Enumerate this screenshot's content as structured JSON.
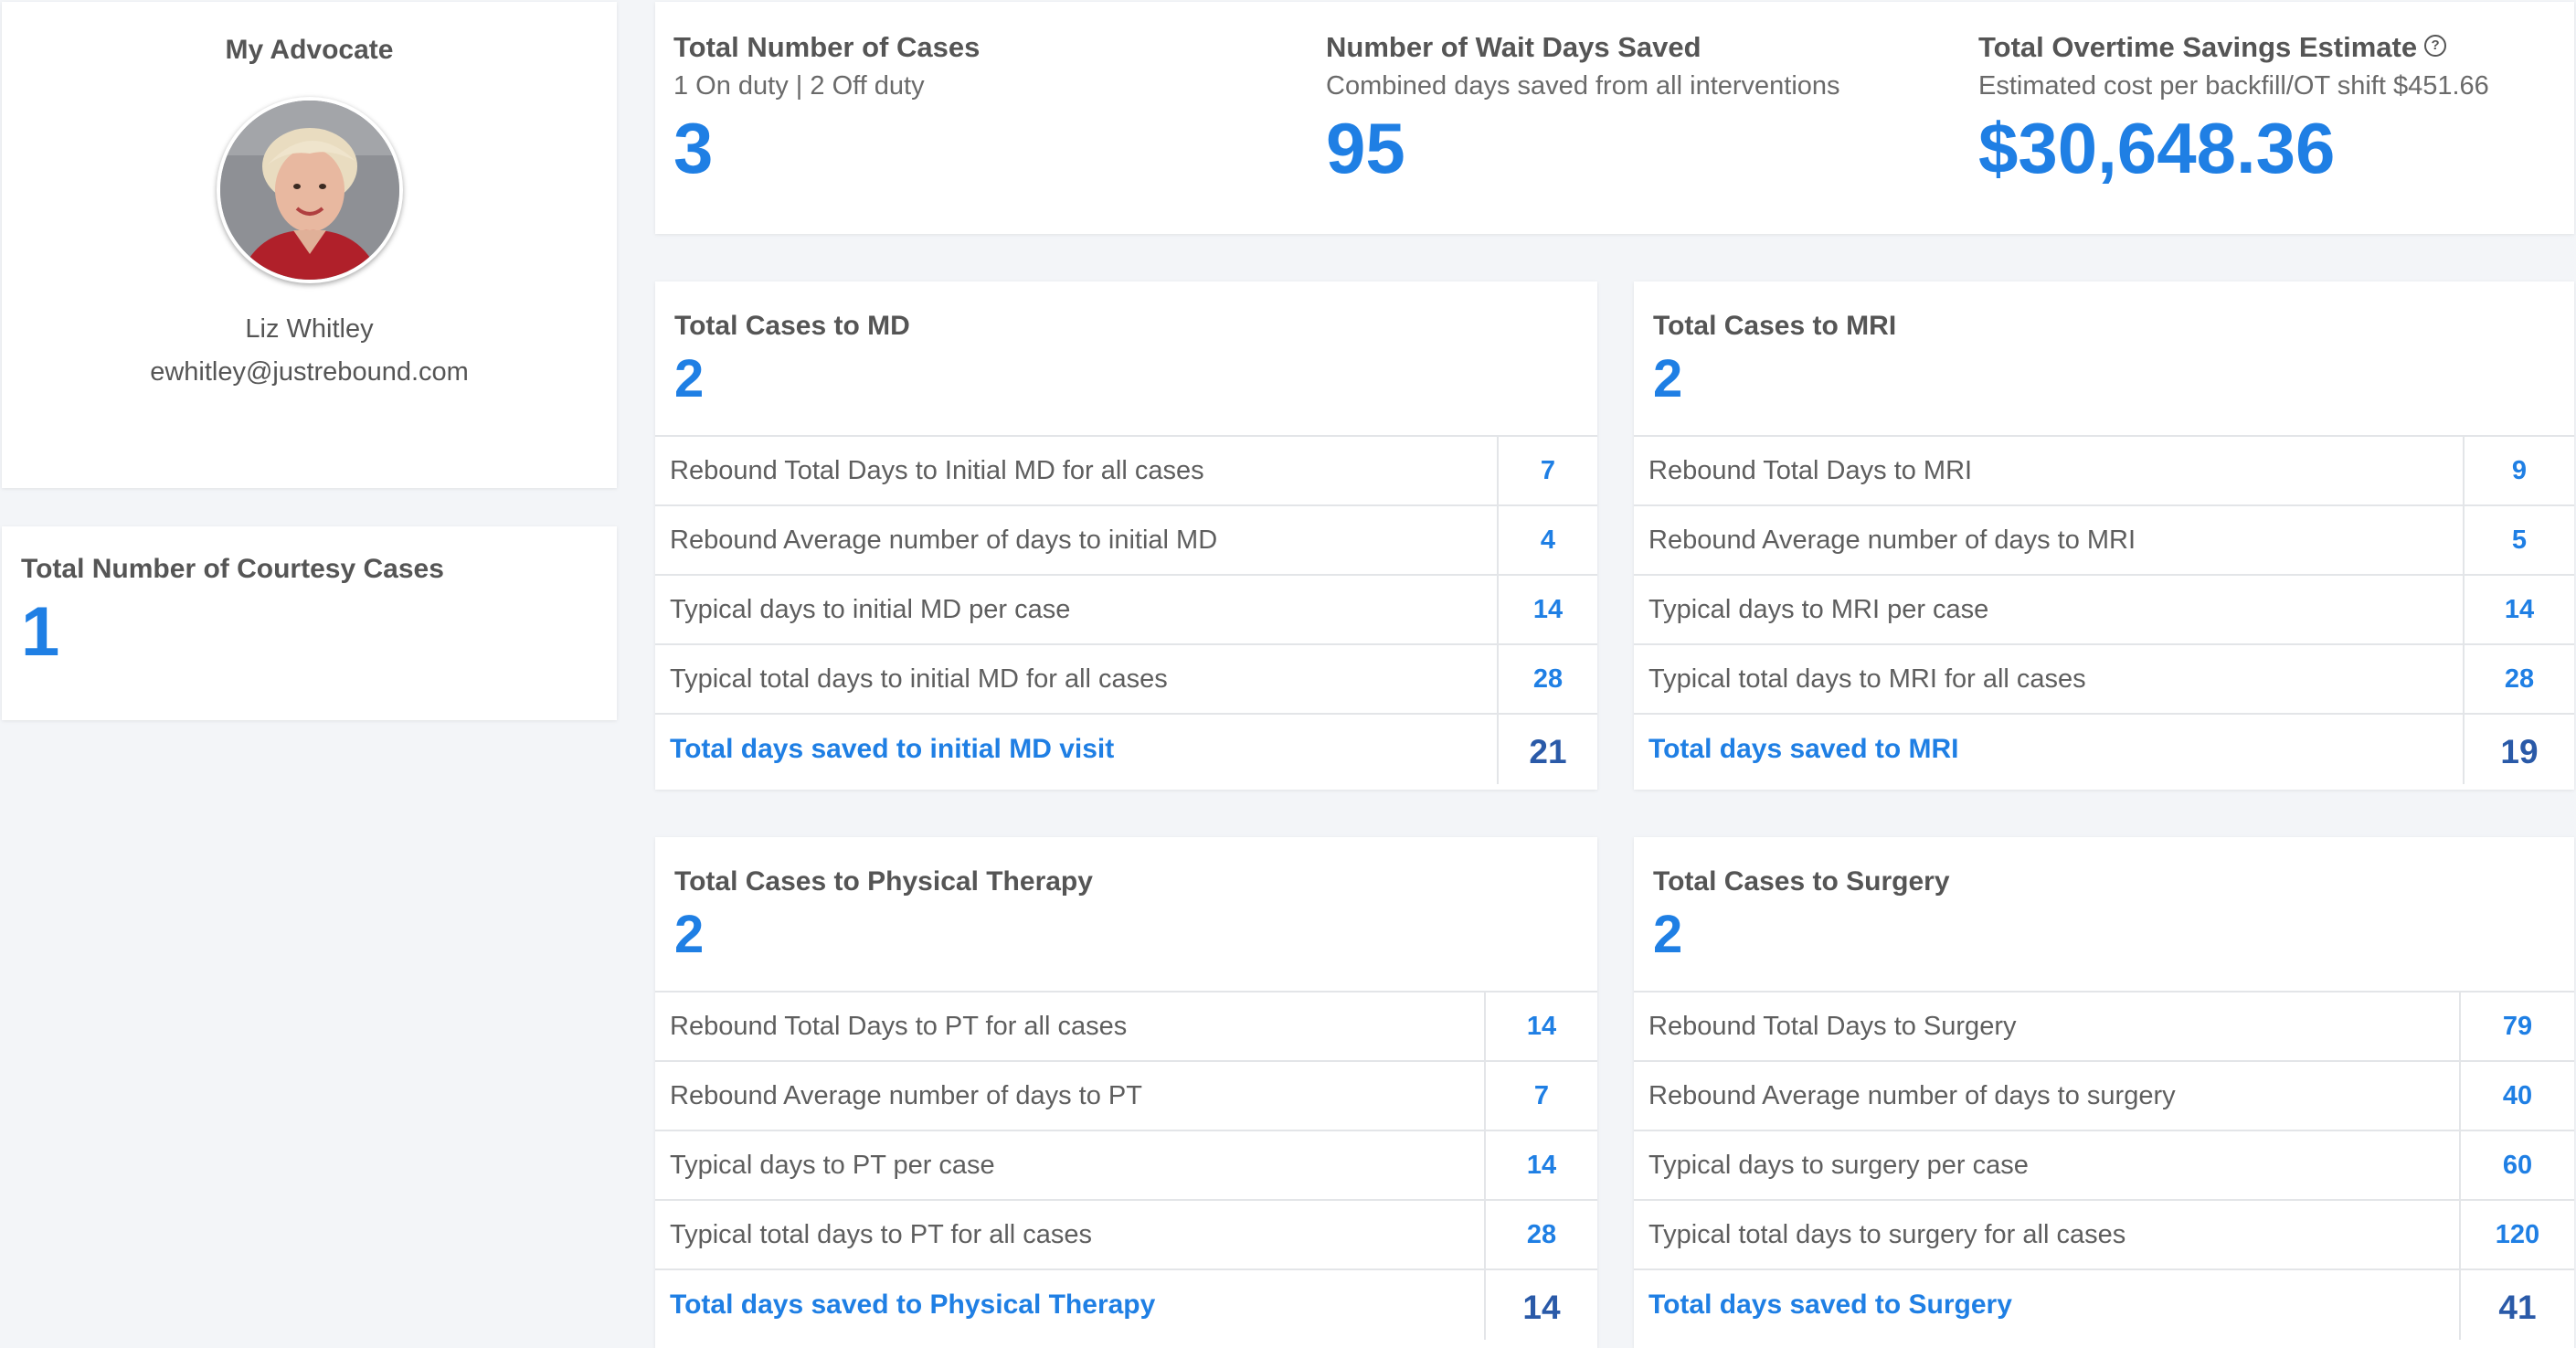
{
  "advocate": {
    "title": "My Advocate",
    "name": "Liz Whitley",
    "email": "ewhitley@justrebound.com"
  },
  "courtesy": {
    "title": "Total Number of Courtesy Cases",
    "value": "1"
  },
  "summary": {
    "cases": {
      "title": "Total Number of Cases",
      "subtitle": "1 On duty | 2 Off duty",
      "value": "3"
    },
    "wait_days": {
      "title": "Number of Wait Days Saved",
      "subtitle": "Combined days saved from all interventions",
      "value": "95"
    },
    "overtime": {
      "title": "Total Overtime Savings Estimate",
      "subtitle": "Estimated cost per backfill/OT shift $451.66",
      "value": "$30,648.36",
      "help_icon": "?"
    }
  },
  "md": {
    "title": "Total Cases to MD",
    "count": "2",
    "rows": [
      {
        "label": "Rebound Total Days to Initial MD for all cases",
        "value": "7"
      },
      {
        "label": "Rebound Average number of days to initial MD",
        "value": "4"
      },
      {
        "label": "Typical days to initial MD per case",
        "value": "14"
      },
      {
        "label": "Typical total days to initial MD for all cases",
        "value": "28"
      },
      {
        "label": "Total days saved to initial MD visit",
        "value": "21"
      }
    ]
  },
  "mri": {
    "title": "Total Cases to MRI",
    "count": "2",
    "rows": [
      {
        "label": "Rebound Total Days to MRI",
        "value": "9"
      },
      {
        "label": "Rebound Average number of days to MRI",
        "value": "5"
      },
      {
        "label": "Typical days to MRI per case",
        "value": "14"
      },
      {
        "label": "Typical total days to MRI for all cases",
        "value": "28"
      },
      {
        "label": "Total days saved to MRI",
        "value": "19"
      }
    ]
  },
  "pt": {
    "title": "Total Cases to Physical Therapy",
    "count": "2",
    "rows": [
      {
        "label": "Rebound Total Days to PT for all cases",
        "value": "14"
      },
      {
        "label": "Rebound Average number of days to PT",
        "value": "7"
      },
      {
        "label": "Typical days to PT per case",
        "value": "14"
      },
      {
        "label": "Typical total days to PT for all cases",
        "value": "28"
      },
      {
        "label": "Total days saved to Physical Therapy",
        "value": "14"
      }
    ]
  },
  "surgery": {
    "title": "Total Cases to Surgery",
    "count": "2",
    "rows": [
      {
        "label": "Rebound Total Days to Surgery",
        "value": "79"
      },
      {
        "label": "Rebound Average number of days to surgery",
        "value": "40"
      },
      {
        "label": "Typical days to surgery per case",
        "value": "60"
      },
      {
        "label": "Typical total days to surgery for all cases",
        "value": "120"
      },
      {
        "label": "Total days saved to Surgery",
        "value": "41"
      }
    ]
  },
  "colors": {
    "accent": "#1f7fe4",
    "total_value": "#2a5aa8",
    "background": "#f3f5f8"
  }
}
